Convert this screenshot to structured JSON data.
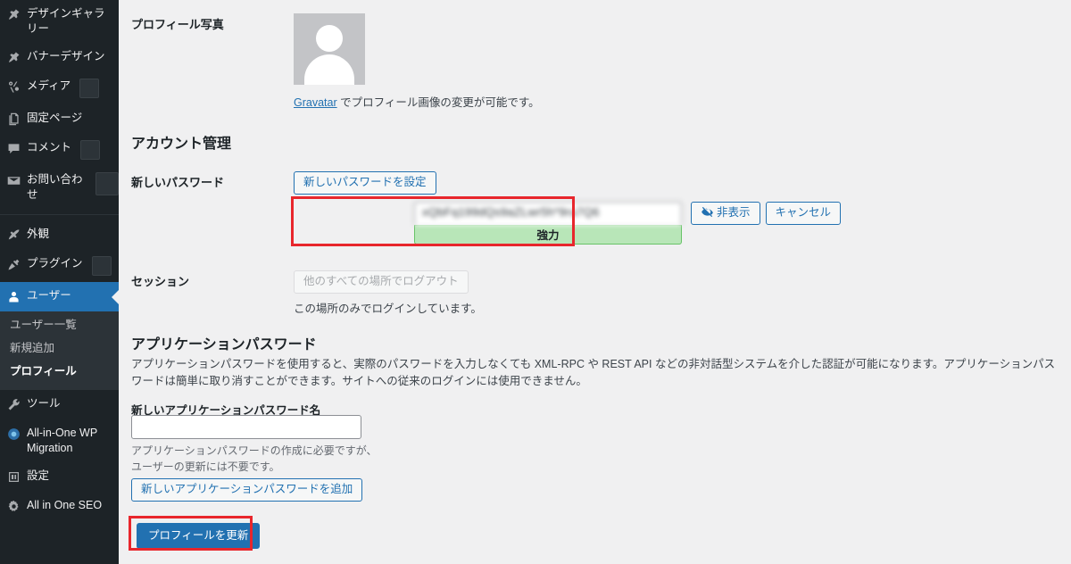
{
  "sidebar": {
    "items": [
      {
        "label": "デザインギャラリー",
        "icon": "pin-icon",
        "badge": null,
        "current": false
      },
      {
        "label": "バナーデザイン",
        "icon": "pin-icon",
        "badge": null,
        "current": false
      },
      {
        "label": "メディア",
        "icon": "media-icon",
        "badge": "",
        "current": false
      },
      {
        "label": "固定ページ",
        "icon": "pages-icon",
        "badge": null,
        "current": false
      },
      {
        "label": "コメント",
        "icon": "comment-icon",
        "badge": "",
        "current": false
      },
      {
        "label": "お問い合わせ",
        "icon": "mail-icon",
        "badge": "",
        "current": false
      },
      {
        "label": "外観",
        "icon": "appearance-icon",
        "badge": null,
        "current": false
      },
      {
        "label": "プラグイン",
        "icon": "plugin-icon",
        "badge": "",
        "current": false
      },
      {
        "label": "ユーザー",
        "icon": "users-icon",
        "badge": null,
        "current": true
      },
      {
        "label": "ツール",
        "icon": "tools-icon",
        "badge": null,
        "current": false
      },
      {
        "label": "All-in-One WP Migration",
        "icon": "migration-icon",
        "badge": null,
        "current": false
      },
      {
        "label": "設定",
        "icon": "settings-icon",
        "badge": null,
        "current": false
      },
      {
        "label": "All in One SEO",
        "icon": "seo-gear-icon",
        "badge": null,
        "current": false
      }
    ],
    "submenu": [
      {
        "label": "ユーザー一覧",
        "current": false
      },
      {
        "label": "新規追加",
        "current": false
      },
      {
        "label": "プロフィール",
        "current": true
      }
    ]
  },
  "profile_photo": {
    "row_label": "プロフィール写真",
    "gravatar_link_text": "Gravatar",
    "gravatar_rest_text": " でプロフィール画像の変更が可能です。"
  },
  "account": {
    "heading": "アカウント管理",
    "password_row_label": "新しいパスワード",
    "set_password_button": "新しいパスワードを設定",
    "password_value": "xQbFq199dQs9aZLwr5h*9ru7Q6",
    "strength_label": "強力",
    "hide_button": "非表示",
    "cancel_button": "キャンセル",
    "session_row_label": "セッション",
    "logout_everywhere_button": "他のすべての場所でログアウト",
    "session_note": "この場所のみでログインしています。"
  },
  "application_passwords": {
    "heading": "アプリケーションパスワード",
    "description": "アプリケーションパスワードを使用すると、実際のパスワードを入力しなくても XML-RPC や REST API などの非対話型システムを介した認証が可能になります。アプリケーションパスワードは簡単に取り消すことができます。サイトへの従来のログインには使用できません。",
    "new_name_label": "新しいアプリケーションパスワード名",
    "new_name_value": "",
    "help_line_1": "アプリケーションパスワードの作成に必要ですが、",
    "help_line_2": "ユーザーの更新には不要です。",
    "add_button": "新しいアプリケーションパスワードを追加"
  },
  "footer": {
    "update_profile_button": "プロフィールを更新"
  },
  "colors": {
    "sidebar_bg": "#1d2327",
    "submenu_bg": "#2c3338",
    "accent_blue": "#2271b1",
    "page_bg": "#f0f0f1",
    "strength_green": "#b8e6b8",
    "annotation_red": "#e8262c"
  }
}
